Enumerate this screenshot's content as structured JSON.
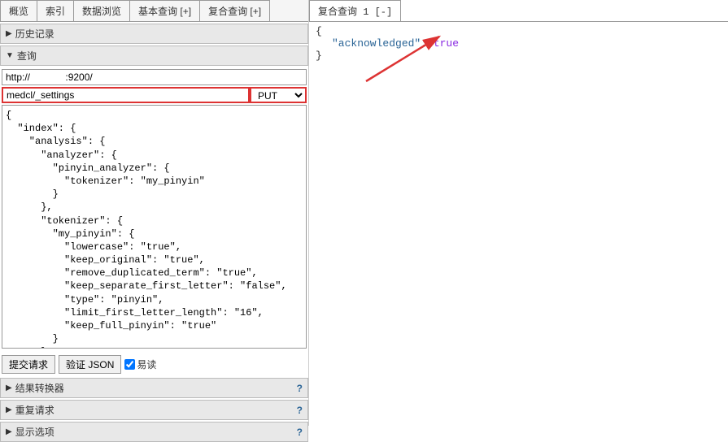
{
  "tabs": {
    "overview": "概览",
    "index": "索引",
    "browse": "数据浏览",
    "basic": "基本查询 [+]",
    "compound": "复合查询 [+]"
  },
  "right_tab": "复合查询 1 [-]",
  "sections": {
    "history": "历史记录",
    "query": "查询",
    "transformer": "结果转换器",
    "repeat": "重复请求",
    "display": "显示选项"
  },
  "query": {
    "url": "http://             :9200/",
    "path": "medcl/_settings",
    "method": "PUT",
    "body": "{\n  \"index\": {\n    \"analysis\": {\n      \"analyzer\": {\n        \"pinyin_analyzer\": {\n          \"tokenizer\": \"my_pinyin\"\n        }\n      },\n      \"tokenizer\": {\n        \"my_pinyin\": {\n          \"lowercase\": \"true\",\n          \"keep_original\": \"true\",\n          \"remove_duplicated_term\": \"true\",\n          \"keep_separate_first_letter\": \"false\",\n          \"type\": \"pinyin\",\n          \"limit_first_letter_length\": \"16\",\n          \"keep_full_pinyin\": \"true\"\n        }\n      }\n    }\n  }\n}"
  },
  "buttons": {
    "submit": "提交请求",
    "validate": "验证 JSON",
    "readable": "易读"
  },
  "response": {
    "open": "{",
    "line": "\"acknowledged\": ",
    "val": "true",
    "close": "}"
  },
  "help": "?"
}
